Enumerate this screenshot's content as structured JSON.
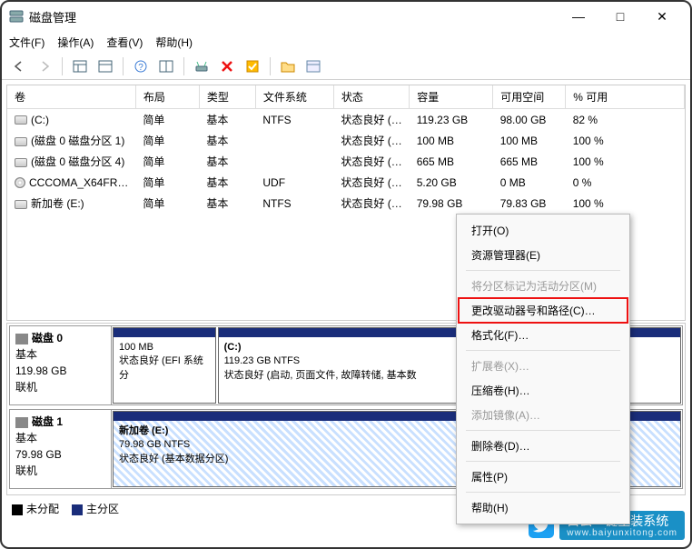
{
  "window": {
    "title": "磁盘管理",
    "controls": {
      "min": "—",
      "max": "□",
      "close": "✕"
    }
  },
  "menu": {
    "file": "文件(F)",
    "action": "操作(A)",
    "view": "查看(V)",
    "help": "帮助(H)"
  },
  "table": {
    "headers": {
      "vol": "卷",
      "layout": "布局",
      "type": "类型",
      "fs": "文件系统",
      "status": "状态",
      "capacity": "容量",
      "free": "可用空间",
      "pct": "% 可用"
    },
    "rows": [
      {
        "icon": "hd",
        "vol": "(C:)",
        "layout": "简单",
        "type": "基本",
        "fs": "NTFS",
        "status": "状态良好 (…",
        "cap": "119.23 GB",
        "free": "98.00 GB",
        "pct": "82 %"
      },
      {
        "icon": "hd",
        "vol": "(磁盘 0 磁盘分区 1)",
        "layout": "简单",
        "type": "基本",
        "fs": "",
        "status": "状态良好 (…",
        "cap": "100 MB",
        "free": "100 MB",
        "pct": "100 %"
      },
      {
        "icon": "hd",
        "vol": "(磁盘 0 磁盘分区 4)",
        "layout": "简单",
        "type": "基本",
        "fs": "",
        "status": "状态良好 (…",
        "cap": "665 MB",
        "free": "665 MB",
        "pct": "100 %"
      },
      {
        "icon": "cd",
        "vol": "CCCOMA_X64FR…",
        "layout": "简单",
        "type": "基本",
        "fs": "UDF",
        "status": "状态良好 (…",
        "cap": "5.20 GB",
        "free": "0 MB",
        "pct": "0 %"
      },
      {
        "icon": "hd",
        "vol": "新加卷 (E:)",
        "layout": "简单",
        "type": "基本",
        "fs": "NTFS",
        "status": "状态良好 (…",
        "cap": "79.98 GB",
        "free": "79.83 GB",
        "pct": "100 %"
      }
    ]
  },
  "disks": [
    {
      "name": "磁盘 0",
      "type": "基本",
      "capacity": "119.98 GB",
      "status": "联机",
      "parts": [
        {
          "width": 18,
          "title": "",
          "line2": "100 MB",
          "line3": "状态良好 (EFI 系统分",
          "hatched": false
        },
        {
          "width": 82,
          "title": "(C:)",
          "line2": "119.23 GB NTFS",
          "line3": "状态良好 (启动, 页面文件, 故障转储, 基本数",
          "hatched": false
        }
      ]
    },
    {
      "name": "磁盘 1",
      "type": "基本",
      "capacity": "79.98 GB",
      "status": "联机",
      "parts": [
        {
          "width": 100,
          "title": "新加卷  (E:)",
          "line2": "79.98 GB NTFS",
          "line3": "状态良好 (基本数据分区)",
          "hatched": true
        }
      ]
    }
  ],
  "legend": {
    "unalloc": "未分配",
    "primary": "主分区"
  },
  "context": {
    "open": "打开(O)",
    "explorer": "资源管理器(E)",
    "markactive": "将分区标记为活动分区(M)",
    "changeletter": "更改驱动器号和路径(C)…",
    "format": "格式化(F)…",
    "extend": "扩展卷(X)…",
    "shrink": "压缩卷(H)…",
    "mirror": "添加镜像(A)…",
    "delete": "删除卷(D)…",
    "properties": "属性(P)",
    "help": "帮助(H)"
  },
  "watermark": {
    "text": "白云一键重装系统",
    "sub": "www.baiyunxitong.com"
  }
}
